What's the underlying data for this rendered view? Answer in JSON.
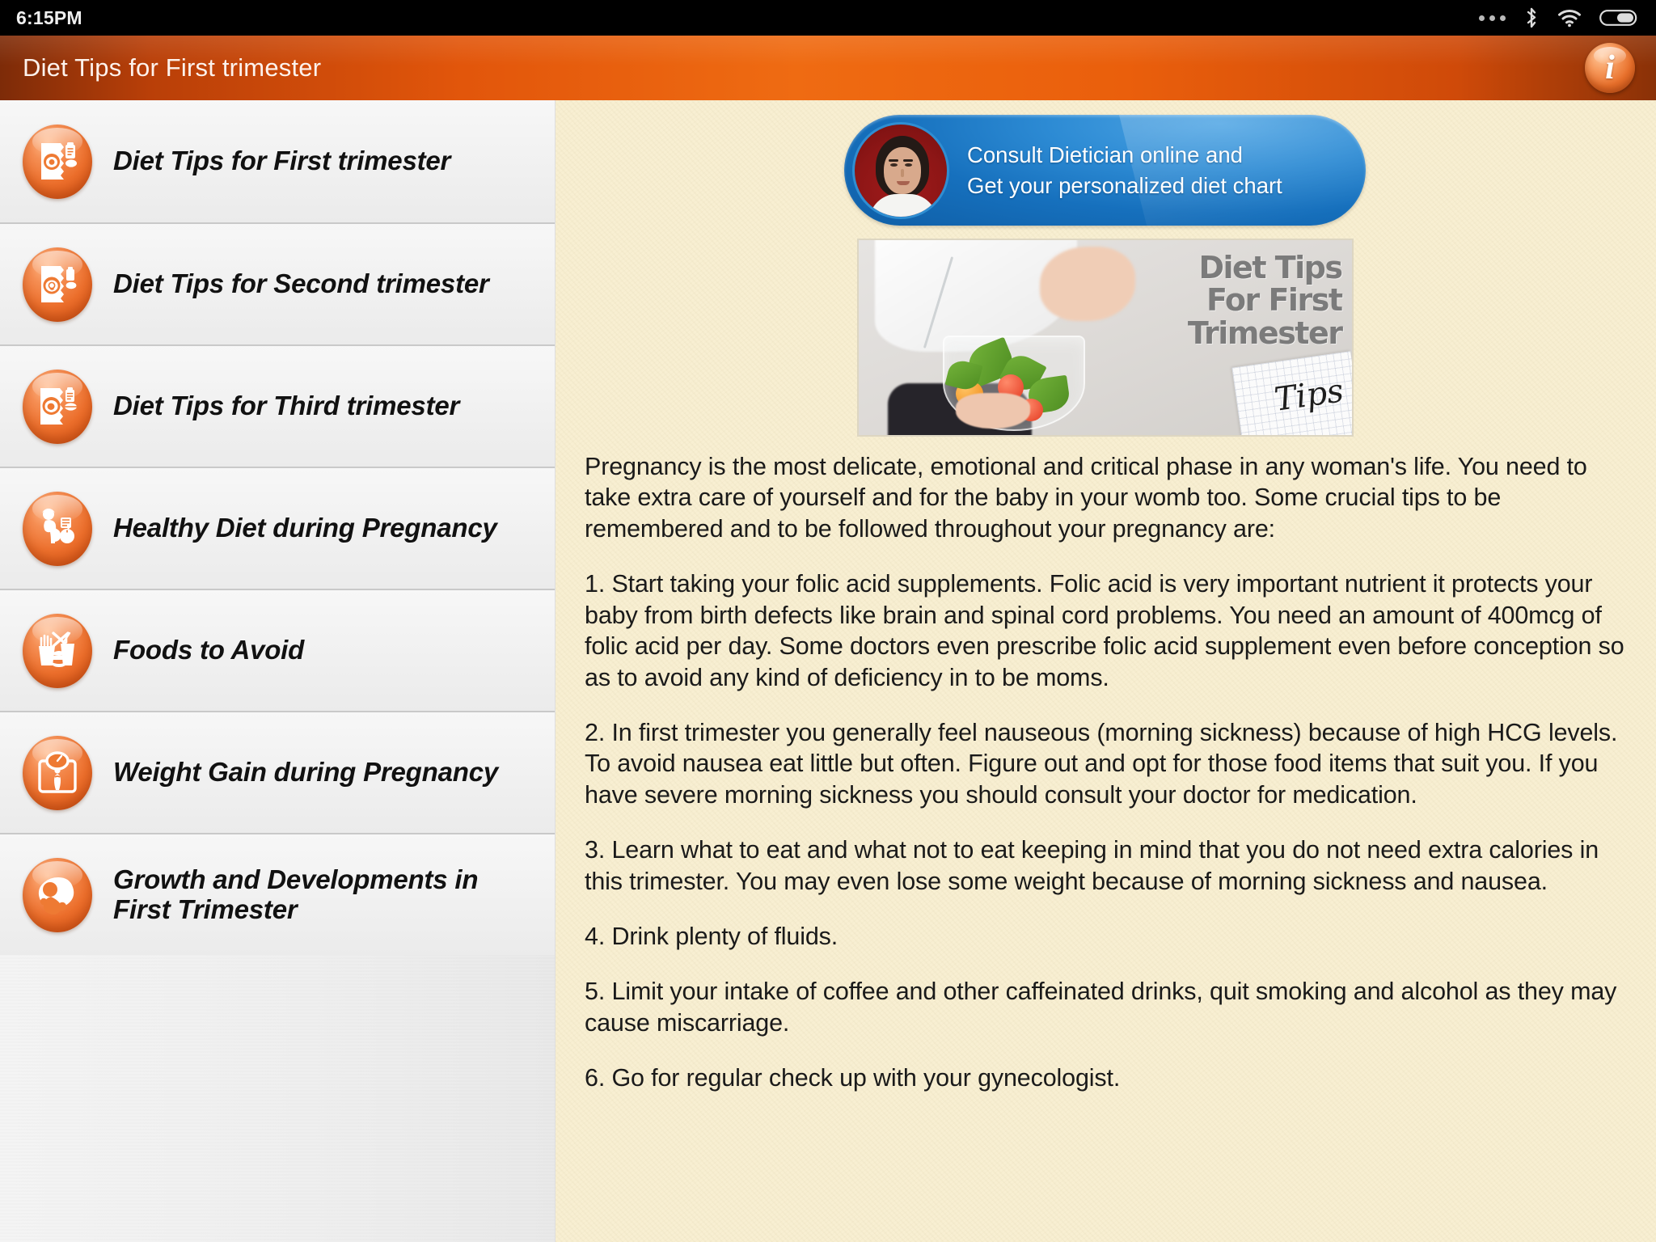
{
  "statusbar": {
    "time": "6:15PM",
    "icons": [
      "more-dots-icon",
      "bluetooth-icon",
      "wifi-icon",
      "battery-icon"
    ]
  },
  "titlebar": {
    "title": "Diet Tips for First trimester",
    "info_label": "i",
    "accent_color": "#e8601a",
    "gradient_dark": "#7d2b08",
    "gradient_bright": "#ef6b12"
  },
  "sidebar": {
    "background": "#f1f1f1",
    "items": [
      {
        "label": "Diet Tips for First trimester",
        "icon": "diet-chart-first-trimester-icon"
      },
      {
        "label": "Diet Tips for Second trimester",
        "icon": "diet-chart-second-trimester-icon"
      },
      {
        "label": "Diet Tips for Third trimester",
        "icon": "diet-chart-third-trimester-icon"
      },
      {
        "label": "Healthy Diet during Pregnancy",
        "icon": "pregnant-woman-apple-icon"
      },
      {
        "label": "Foods to Avoid",
        "icon": "junk-food-crossed-icon"
      },
      {
        "label": "Weight Gain during Pregnancy",
        "icon": "weighing-scale-icon"
      },
      {
        "label": "Growth and Developments in First Trimester",
        "icon": "fetus-icon"
      }
    ]
  },
  "content": {
    "background": "#f8efd2",
    "promo": {
      "line1": "Consult Dietician online and",
      "line2": "Get your personalized diet chart",
      "avatar": "dietician-photo-avatar",
      "color": "#1670bd"
    },
    "hero": {
      "title_line1": "Diet Tips",
      "title_line2": "For First",
      "title_line3": "Trimester",
      "note_text": "Tips",
      "alt": "pregnant-woman-holding-salad-bowl-image"
    },
    "article": {
      "intro": "Pregnancy is the most delicate, emotional and critical phase in any woman's life. You need to take extra care of yourself and for the baby in your womb too. Some crucial tips to be remembered and to be followed throughout your pregnancy are:",
      "tips": [
        "1. Start taking your folic acid supplements. Folic acid is very important nutrient it protects your baby from birth defects like brain and spinal cord problems. You need an amount of 400mcg of folic acid per day. Some doctors even prescribe folic acid supplement even before conception so as to avoid any kind of deficiency in to be moms.",
        "2. In first trimester you generally feel nauseous (morning sickness) because of high HCG levels. To avoid nausea eat little but often. Figure out and opt for those food items that suit you. If you have severe morning sickness you should consult your doctor for medication.",
        "3. Learn what to eat and what not to eat keeping in mind that you do not need extra calories in this trimester. You may even lose some weight because of morning sickness and nausea.",
        "4. Drink plenty of fluids.",
        "5. Limit your intake of coffee and other caffeinated drinks, quit smoking and alcohol as they may cause miscarriage.",
        "6. Go for regular check up with your gynecologist."
      ]
    }
  }
}
